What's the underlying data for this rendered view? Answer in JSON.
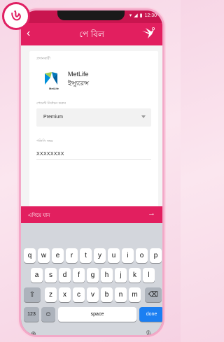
{
  "step_badge": "৬",
  "status": {
    "time": "12:30"
  },
  "appbar": {
    "title": "পে বিল"
  },
  "form": {
    "provider_label": "প্রদানকারী",
    "provider_logo_text": "MetLife",
    "provider_name_line1": "MetLife",
    "provider_name_line2": "ইন্স্যুরেন্স",
    "payment_type_label": "পেমেন্ট নির্বাচন করুন",
    "payment_type_value": "Premium",
    "policy_label": "পলিসি নম্বর",
    "policy_value": "XXXXXXXX"
  },
  "proceed": {
    "label": "এগিয়ে যান",
    "arrow": "→"
  },
  "keyboard": {
    "row1": [
      "q",
      "w",
      "e",
      "r",
      "t",
      "y",
      "u",
      "i",
      "o",
      "p"
    ],
    "row2": [
      "a",
      "s",
      "d",
      "f",
      "g",
      "h",
      "j",
      "k",
      "l"
    ],
    "row3": [
      "z",
      "x",
      "c",
      "v",
      "b",
      "n",
      "m"
    ],
    "shift": "⇧",
    "backspace": "⌫",
    "numbers": "123",
    "emoji": "☺",
    "space": "space",
    "done": "done",
    "globe": "⊕",
    "mic": "🎙"
  },
  "colors": {
    "brand": "#e21f5f",
    "done_key": "#1b7ff2"
  }
}
